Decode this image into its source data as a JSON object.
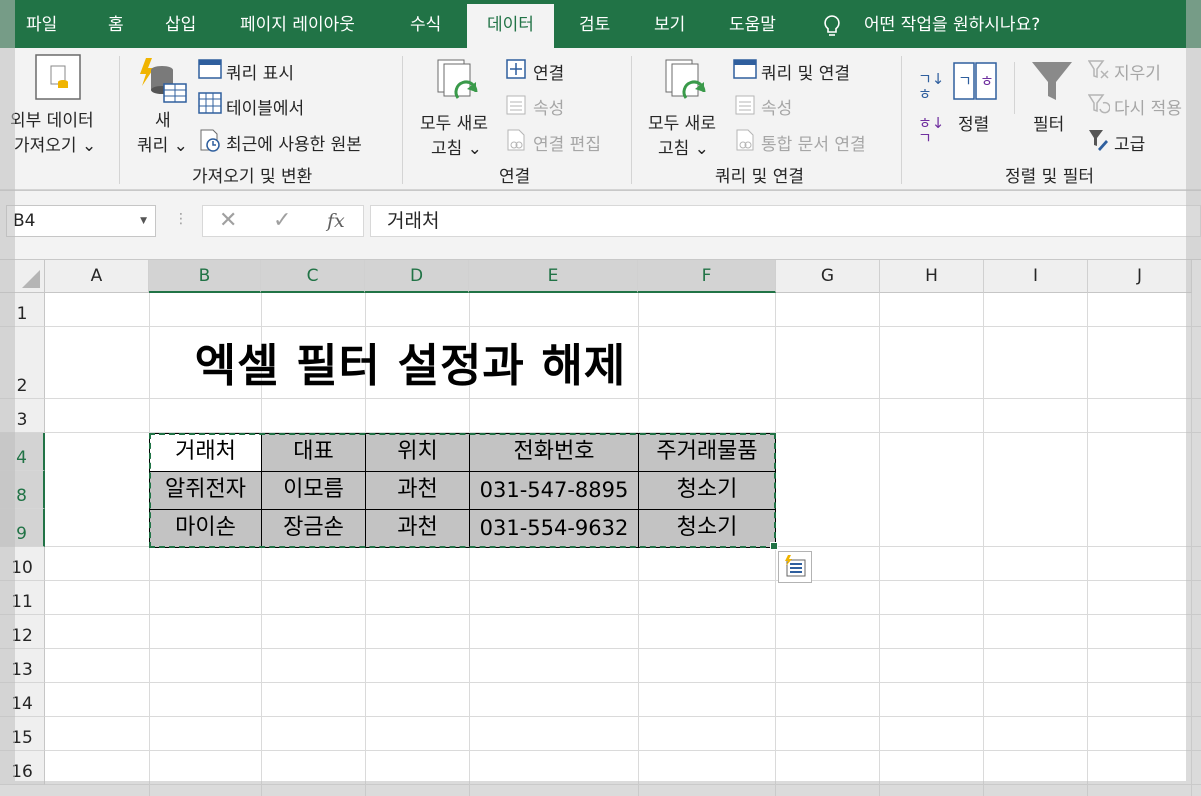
{
  "tabs": [
    {
      "label": "파일"
    },
    {
      "label": "홈"
    },
    {
      "label": "삽입"
    },
    {
      "label": "페이지 레이아웃"
    },
    {
      "label": "수식"
    },
    {
      "label": "데이터",
      "active": true
    },
    {
      "label": "검토"
    },
    {
      "label": "보기"
    },
    {
      "label": "도움말"
    }
  ],
  "tell_me": "어떤 작업을 원하시나요?",
  "ribbon": {
    "external_data_1": "외부 데이터",
    "external_data_2": "가져오기 ⌄",
    "new_query_1": "새",
    "new_query_2": "쿼리 ⌄",
    "show_queries": "쿼리 표시",
    "from_table": "테이블에서",
    "recent_sources": "최근에 사용한 원본",
    "group_get_transform": "가져오기 및 변환",
    "refresh_all_1": "모두 새로",
    "refresh_all_2": "고침 ⌄",
    "connections": "연결",
    "properties": "속성",
    "edit_links": "연결 편집",
    "group_connections": "연결",
    "refresh_all_b1": "모두 새로",
    "refresh_all_b2": "고침 ⌄",
    "queries_connections": "쿼리 및 연결",
    "properties_b": "속성",
    "workbook_links": "통합 문서 연결",
    "group_queries": "쿼리 및 연결",
    "sort": "정렬",
    "filter": "필터",
    "clear": "지우기",
    "reapply": "다시 적용",
    "advanced": "고급",
    "group_sort_filter": "정렬 및 필터"
  },
  "formula_bar": {
    "name_box": "B4",
    "fx": "fx",
    "content": "거래처"
  },
  "columns": [
    "A",
    "B",
    "C",
    "D",
    "E",
    "F",
    "G",
    "H",
    "I",
    "J"
  ],
  "rows": [
    "1",
    "2",
    "3",
    "4",
    "8",
    "9",
    "10",
    "11",
    "12",
    "13",
    "14",
    "15",
    "16"
  ],
  "selected_columns": [
    "B",
    "C",
    "D",
    "E",
    "F"
  ],
  "sheet_title": "엑셀 필터 설정과 해제",
  "table": {
    "headers": [
      "거래처",
      "대표",
      "위치",
      "전화번호",
      "주거래물품"
    ],
    "rows": [
      [
        "알쥐전자",
        "이모름",
        "과천",
        "031-547-8895",
        "청소기"
      ],
      [
        "마이손",
        "장금손",
        "과천",
        "031-554-9632",
        "청소기"
      ]
    ]
  },
  "colors": {
    "excel_green": "#217346",
    "filtered_cell_gray": "#c3c3c3"
  }
}
